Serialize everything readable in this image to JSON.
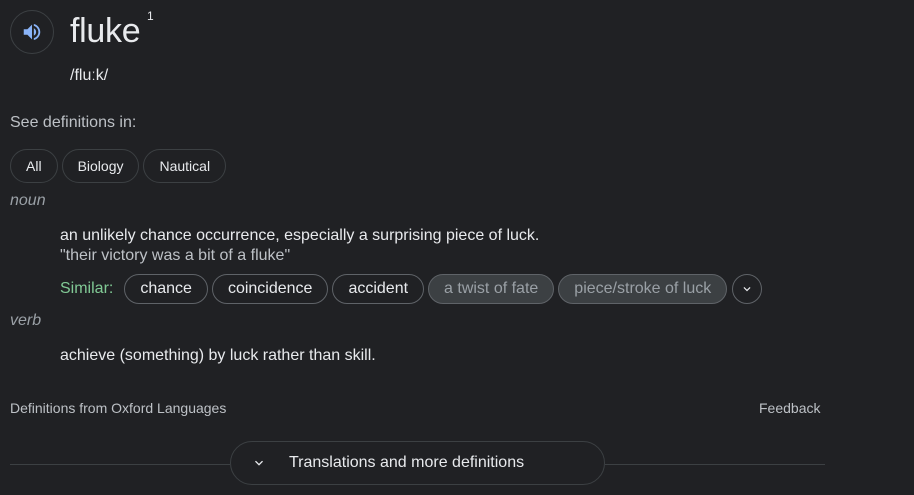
{
  "entry": {
    "word": "fluke",
    "homograph": "1",
    "phonetic": "/fluːk/",
    "speaker_icon": "speaker-icon"
  },
  "see_definitions": {
    "label": "See definitions in:",
    "chips": [
      "All",
      "Biology",
      "Nautical"
    ]
  },
  "senses": [
    {
      "pos": "noun",
      "definition": "an unlikely chance occurrence, especially a surprising piece of luck.",
      "example": "\"their victory was a bit of a fluke\"",
      "similar_label": "Similar:",
      "similar": [
        {
          "text": "chance",
          "dim": false
        },
        {
          "text": "coincidence",
          "dim": false
        },
        {
          "text": "accident",
          "dim": false
        },
        {
          "text": "a twist of fate",
          "dim": true
        },
        {
          "text": "piece/stroke of luck",
          "dim": true
        }
      ]
    },
    {
      "pos": "verb",
      "definition": "achieve (something) by luck rather than skill."
    }
  ],
  "footer": {
    "source": "Definitions from Oxford Languages",
    "feedback": "Feedback",
    "more_button": "Translations and more definitions"
  },
  "colors": {
    "background": "#202124",
    "similar_label": "#81c995",
    "speaker_icon": "#8ab4f8"
  }
}
